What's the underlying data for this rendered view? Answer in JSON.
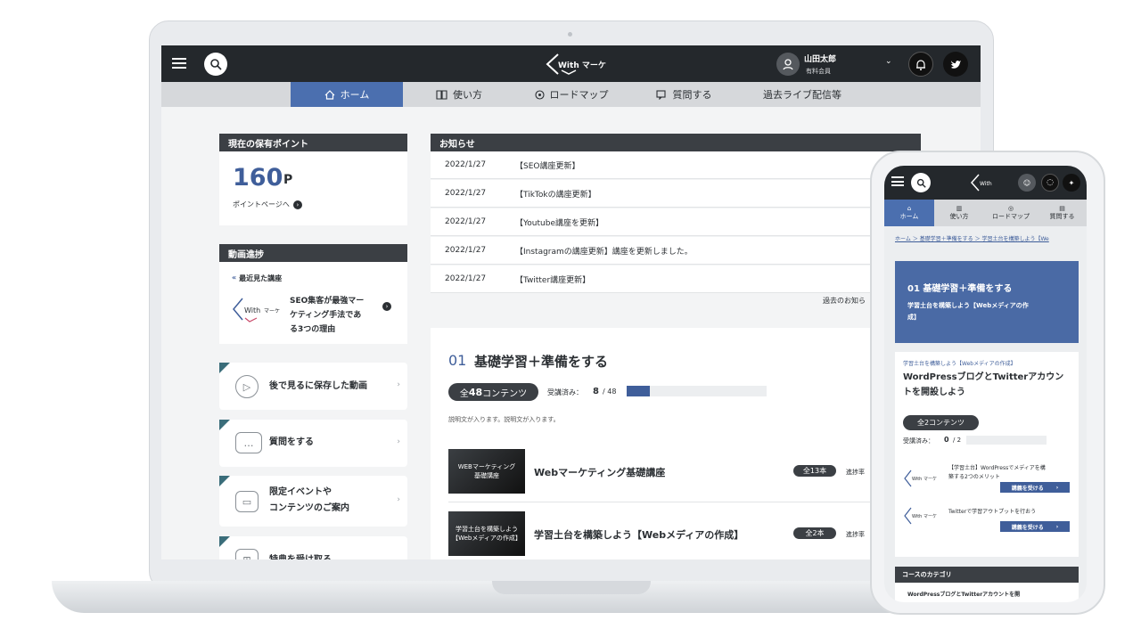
{
  "header": {
    "logo_text": "With マーケ",
    "user_name": "山田太郎",
    "user_role": "有料会員"
  },
  "nav": {
    "items": [
      {
        "label": "ホーム",
        "icon": "home-icon",
        "active": true
      },
      {
        "label": "使い方",
        "icon": "book-icon"
      },
      {
        "label": "ロードマップ",
        "icon": "pin-icon"
      },
      {
        "label": "質問する",
        "icon": "chat-icon"
      },
      {
        "label": "過去ライブ配信等",
        "icon": ""
      }
    ]
  },
  "points": {
    "header": "現在の保有ポイント",
    "value": "160",
    "unit": "P",
    "link": "ポイントページへ"
  },
  "progress": {
    "header": "動画進捗",
    "recent_label": "最近見た講座",
    "recent_title": "SEO集客が最強マーケティング手法である3つの理由",
    "recent_title_lines": [
      "SEO集客が最強マー",
      "ケティング手法であ",
      "る3つの理由"
    ]
  },
  "cards": [
    {
      "label": "後で見るに保存した動画",
      "icon": "play-icon"
    },
    {
      "label": "質問をする",
      "icon": "chat-bubble-icon"
    },
    {
      "label_lines": [
        "限定イベントや",
        "コンテンツのご案内"
      ],
      "icon": "calendar-icon"
    },
    {
      "label": "特典を受け取る",
      "icon": "gift-icon"
    }
  ],
  "news": {
    "header": "お知らせ",
    "items": [
      {
        "date": "2022/1/27",
        "title": "【SEO講座更新】"
      },
      {
        "date": "2022/1/27",
        "title": "【TikTokの講座更新】"
      },
      {
        "date": "2022/1/27",
        "title": "【Youtube講座を更新】"
      },
      {
        "date": "2022/1/27",
        "title": "【Instagramの講座更新】講座を更新しました。"
      },
      {
        "date": "2022/1/27",
        "title": "【Twitter講座更新】"
      }
    ],
    "more_link": "過去のお知ら"
  },
  "course": {
    "number": "01",
    "title": "基礎学習＋準備をする",
    "total_label": "全48コンテンツ",
    "total_prefix": "全",
    "total_count": "48",
    "total_suffix": "コンテンツ",
    "taken_label": "受講済み：",
    "taken_value": "8",
    "taken_total": "/ 48",
    "progress_fraction": 0.167,
    "description": "説明文が入ります。説明文が入ります。",
    "lessons": [
      {
        "thumb_lines": [
          "WEBマーケティング",
          "基礎講座"
        ],
        "title": "Webマーケティング基礎講座",
        "badge": "全13本",
        "status": "進捗率"
      },
      {
        "thumb_lines": [
          "学習土台を構築しよう",
          "【Webメディアの作成】"
        ],
        "title": "学習土台を構築しよう【Webメディアの作成】",
        "badge": "全2本",
        "status": "進捗率"
      }
    ]
  },
  "phone": {
    "nav": [
      "ホーム",
      "使い方",
      "ロードマップ",
      "質問する"
    ],
    "breadcrumb": "ホーム ＞ 基礎学習＋準備をする ＞ 学習土台を構築しよう【We",
    "hero_title": "01 基礎学習＋準備をする",
    "hero_sub_lines": [
      "学習土台を構築しよう【Webメディアの作",
      "成】"
    ],
    "section_tag": "学習土台を構築しよう【Webメディアの作成】",
    "section_title_lines": [
      "WordPressブログとTwitterアカウン",
      "トを開設しよう"
    ],
    "total_label": "全2コンテンツ",
    "taken_label": "受講済み：",
    "taken_value": "0",
    "taken_total": "/ 2",
    "lessons": [
      {
        "title_lines": [
          "【学習土台】WordPressでメディアを構",
          "築する2つのメリット"
        ],
        "button": "講義を受ける"
      },
      {
        "title_lines": [
          "Twitterで学習アウトプットを行おう"
        ],
        "button": "講義を受ける"
      }
    ],
    "category_header": "コースのカテゴリ",
    "category_item": "WordPressブログとTwitterアカウントを開"
  },
  "colors": {
    "accent": "#4b6faf",
    "dark": "#24282c",
    "panel_header": "#3b3f44",
    "card_corner": "#3a6d7a"
  }
}
